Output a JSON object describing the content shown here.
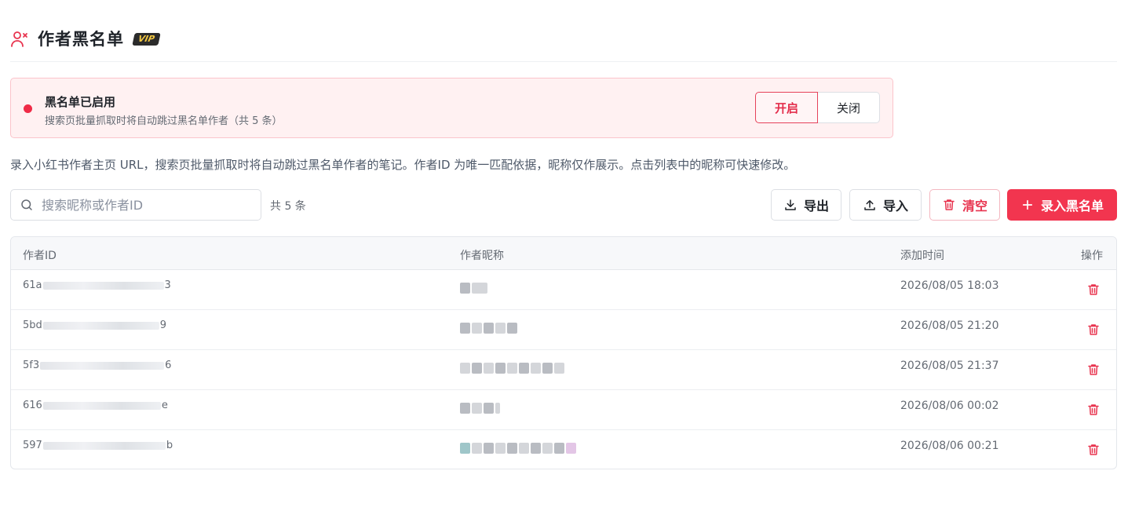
{
  "header": {
    "title": "作者黑名单",
    "badge": "VIP"
  },
  "banner": {
    "title": "黑名单已启用",
    "description": "搜索页批量抓取时将自动跳过黑名单作者（共 5 条）",
    "on_label": "开启",
    "off_label": "关闭"
  },
  "description": "录入小红书作者主页 URL，搜索页批量抓取时将自动跳过黑名单作者的笔记。作者ID 为唯一匹配依据，昵称仅作展示。点击列表中的昵称可快速修改。",
  "toolbar": {
    "search_placeholder": "搜索昵称或作者ID",
    "count": "共 5 条",
    "export_label": "导出",
    "import_label": "导入",
    "clear_label": "清空",
    "add_label": "录入黑名单"
  },
  "table": {
    "columns": {
      "id": "作者ID",
      "nickname": "作者昵称",
      "time": "添加时间",
      "action": "操作"
    },
    "rows": [
      {
        "id_prefix": "61a",
        "id_suffix": "3",
        "time": "2026/08/05 18:03"
      },
      {
        "id_prefix": "5bd",
        "id_suffix": "9",
        "time": "2026/08/05 21:20"
      },
      {
        "id_prefix": "5f3",
        "id_suffix": "6",
        "time": "2026/08/05 21:37"
      },
      {
        "id_prefix": "616",
        "id_suffix": "e",
        "time": "2026/08/06 00:02"
      },
      {
        "id_prefix": "597",
        "id_suffix": "b",
        "time": "2026/08/06 00:21"
      }
    ]
  },
  "colors": {
    "accent": "#f2354f",
    "banner_bg": "#fff1f2",
    "banner_border": "#fbc4cb"
  }
}
